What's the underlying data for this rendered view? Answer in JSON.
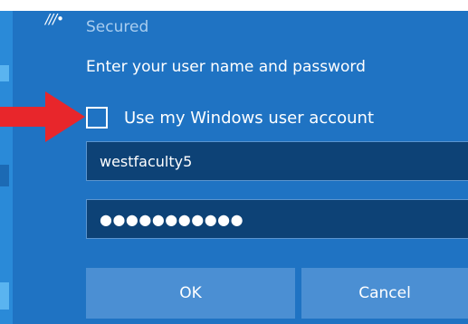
{
  "dialog": {
    "network_icon": "wifi-icon",
    "status_text": "Secured",
    "prompt": "Enter your user name and password",
    "checkbox": {
      "label": "Use my Windows user account",
      "checked": false
    },
    "username": {
      "value": "westfaculty5"
    },
    "password": {
      "masked_value": "●●●●●●●●●●●"
    },
    "buttons": {
      "ok_label": "OK",
      "cancel_label": "Cancel"
    }
  },
  "annotation": {
    "arrow_color": "#e8262b",
    "arrow_icon": "red-pointer-arrow"
  },
  "colors": {
    "dialog_bg": "#1f73c3",
    "field_bg": "#0d4276",
    "button_bg": "#4b8fd3",
    "secondary_text": "#a9cdef"
  }
}
